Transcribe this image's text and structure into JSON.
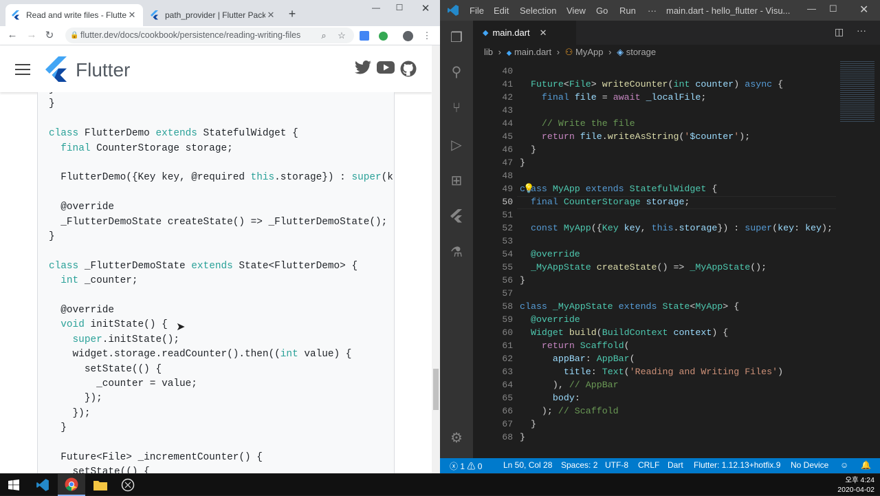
{
  "chrome": {
    "tabs": [
      {
        "title": "Read and write files - Flutter"
      },
      {
        "title": "path_provider | Flutter Package"
      }
    ],
    "url": "flutter.dev/docs/cookbook/persistence/reading-writing-files",
    "brand": "Flutter",
    "code_lines": [
      {
        "segs": [
          {
            "t": "}"
          }
        ]
      },
      {
        "segs": [
          {
            "t": "}"
          }
        ]
      },
      {
        "segs": [
          {
            "t": ""
          }
        ]
      },
      {
        "segs": [
          {
            "t": "class",
            "c": "k"
          },
          {
            "t": " FlutterDemo "
          },
          {
            "t": "extends",
            "c": "k"
          },
          {
            "t": " StatefulWidget {"
          }
        ]
      },
      {
        "segs": [
          {
            "t": "  "
          },
          {
            "t": "final",
            "c": "k"
          },
          {
            "t": " CounterStorage storage;"
          }
        ]
      },
      {
        "segs": [
          {
            "t": ""
          }
        ]
      },
      {
        "segs": [
          {
            "t": "  FlutterDemo({Key key, @required "
          },
          {
            "t": "this",
            "c": "k"
          },
          {
            "t": ".storage}) : "
          },
          {
            "t": "super",
            "c": "k"
          },
          {
            "t": "(k"
          }
        ]
      },
      {
        "segs": [
          {
            "t": ""
          }
        ]
      },
      {
        "segs": [
          {
            "t": "  @override"
          }
        ]
      },
      {
        "segs": [
          {
            "t": "  _FlutterDemoState createState() => _FlutterDemoState();"
          }
        ]
      },
      {
        "segs": [
          {
            "t": "}"
          }
        ]
      },
      {
        "segs": [
          {
            "t": ""
          }
        ]
      },
      {
        "segs": [
          {
            "t": "class",
            "c": "k"
          },
          {
            "t": " _FlutterDemoState "
          },
          {
            "t": "extends",
            "c": "k"
          },
          {
            "t": " State<FlutterDemo> {"
          }
        ]
      },
      {
        "segs": [
          {
            "t": "  "
          },
          {
            "t": "int",
            "c": "k"
          },
          {
            "t": " _counter;"
          }
        ]
      },
      {
        "segs": [
          {
            "t": ""
          }
        ]
      },
      {
        "segs": [
          {
            "t": "  @override"
          }
        ]
      },
      {
        "segs": [
          {
            "t": "  "
          },
          {
            "t": "void",
            "c": "k"
          },
          {
            "t": " initState() {"
          }
        ]
      },
      {
        "segs": [
          {
            "t": "    "
          },
          {
            "t": "super",
            "c": "k"
          },
          {
            "t": ".initState();"
          }
        ]
      },
      {
        "segs": [
          {
            "t": "    widget.storage.readCounter().then(("
          },
          {
            "t": "int",
            "c": "k"
          },
          {
            "t": " value) {"
          }
        ]
      },
      {
        "segs": [
          {
            "t": "      setState(() {"
          }
        ]
      },
      {
        "segs": [
          {
            "t": "        _counter = value;"
          }
        ]
      },
      {
        "segs": [
          {
            "t": "      });"
          }
        ]
      },
      {
        "segs": [
          {
            "t": "    });"
          }
        ]
      },
      {
        "segs": [
          {
            "t": "  }"
          }
        ]
      },
      {
        "segs": [
          {
            "t": ""
          }
        ]
      },
      {
        "segs": [
          {
            "t": "  Future<File> _incrementCounter() {"
          }
        ]
      },
      {
        "segs": [
          {
            "t": "    setState(() {"
          }
        ]
      }
    ]
  },
  "vscode": {
    "menu": [
      "File",
      "Edit",
      "Selection",
      "View",
      "Go",
      "Run",
      "···"
    ],
    "window_title": "main.dart - hello_flutter - Visu...",
    "tab": "main.dart",
    "breadcrumb": {
      "folder": "lib",
      "file": "main.dart",
      "class": "MyApp",
      "field": "storage"
    },
    "code": [
      {
        "n": "40",
        "segs": []
      },
      {
        "n": "41",
        "segs": [
          {
            "t": "  "
          },
          {
            "t": "Future",
            "c": "ty"
          },
          {
            "t": "<"
          },
          {
            "t": "File",
            "c": "ty"
          },
          {
            "t": "> "
          },
          {
            "t": "writeCounter",
            "c": "fn"
          },
          {
            "t": "("
          },
          {
            "t": "int",
            "c": "ty"
          },
          {
            "t": " "
          },
          {
            "t": "counter",
            "c": "vr"
          },
          {
            "t": ") "
          },
          {
            "t": "async",
            "c": "kw"
          },
          {
            "t": " {"
          }
        ]
      },
      {
        "n": "42",
        "segs": [
          {
            "t": "    "
          },
          {
            "t": "final",
            "c": "kw"
          },
          {
            "t": " "
          },
          {
            "t": "file",
            "c": "vr"
          },
          {
            "t": " = "
          },
          {
            "t": "await",
            "c": "ct"
          },
          {
            "t": " "
          },
          {
            "t": "_localFile",
            "c": "vr"
          },
          {
            "t": ";"
          }
        ]
      },
      {
        "n": "43",
        "segs": []
      },
      {
        "n": "44",
        "segs": [
          {
            "t": "    "
          },
          {
            "t": "// Write the file",
            "c": "cm"
          }
        ]
      },
      {
        "n": "45",
        "segs": [
          {
            "t": "    "
          },
          {
            "t": "return",
            "c": "ct"
          },
          {
            "t": " "
          },
          {
            "t": "file",
            "c": "vr"
          },
          {
            "t": "."
          },
          {
            "t": "writeAsString",
            "c": "fn"
          },
          {
            "t": "("
          },
          {
            "t": "'",
            "c": "st"
          },
          {
            "t": "$counter",
            "c": "vr"
          },
          {
            "t": "'",
            "c": "st"
          },
          {
            "t": ");"
          }
        ]
      },
      {
        "n": "46",
        "segs": [
          {
            "t": "  }"
          }
        ]
      },
      {
        "n": "47",
        "segs": [
          {
            "t": "}"
          }
        ]
      },
      {
        "n": "48",
        "segs": []
      },
      {
        "n": "49",
        "segs": [
          {
            "t": "class",
            "c": "kw"
          },
          {
            "t": " "
          },
          {
            "t": "MyApp",
            "c": "ty"
          },
          {
            "t": " "
          },
          {
            "t": "extends",
            "c": "kw"
          },
          {
            "t": " "
          },
          {
            "t": "StatefulWidget",
            "c": "ty"
          },
          {
            "t": " {"
          }
        ]
      },
      {
        "n": "50",
        "segs": [
          {
            "t": "  "
          },
          {
            "t": "final",
            "c": "kw"
          },
          {
            "t": " "
          },
          {
            "t": "CounterStorage",
            "c": "ty"
          },
          {
            "t": " "
          },
          {
            "t": "storage",
            "c": "vr"
          },
          {
            "t": ";"
          }
        ]
      },
      {
        "n": "51",
        "segs": []
      },
      {
        "n": "52",
        "segs": [
          {
            "t": "  "
          },
          {
            "t": "const",
            "c": "kw"
          },
          {
            "t": " "
          },
          {
            "t": "MyApp",
            "c": "ty"
          },
          {
            "t": "({"
          },
          {
            "t": "Key",
            "c": "ty"
          },
          {
            "t": " "
          },
          {
            "t": "key",
            "c": "vr"
          },
          {
            "t": ", "
          },
          {
            "t": "this",
            "c": "kw"
          },
          {
            "t": "."
          },
          {
            "t": "storage",
            "c": "vr"
          },
          {
            "t": "}) : "
          },
          {
            "t": "super",
            "c": "kw"
          },
          {
            "t": "("
          },
          {
            "t": "key",
            "c": "vr"
          },
          {
            "t": ": "
          },
          {
            "t": "key",
            "c": "vr"
          },
          {
            "t": ");"
          }
        ]
      },
      {
        "n": "53",
        "segs": []
      },
      {
        "n": "54",
        "segs": [
          {
            "t": "  "
          },
          {
            "t": "@override",
            "c": "ty"
          }
        ]
      },
      {
        "n": "55",
        "segs": [
          {
            "t": "  "
          },
          {
            "t": "_MyAppState",
            "c": "ty"
          },
          {
            "t": " "
          },
          {
            "t": "createState",
            "c": "fn"
          },
          {
            "t": "() => "
          },
          {
            "t": "_MyAppState",
            "c": "ty"
          },
          {
            "t": "();"
          }
        ]
      },
      {
        "n": "56",
        "segs": [
          {
            "t": "}"
          }
        ]
      },
      {
        "n": "57",
        "segs": []
      },
      {
        "n": "58",
        "segs": [
          {
            "t": "class",
            "c": "kw"
          },
          {
            "t": " "
          },
          {
            "t": "_MyAppState",
            "c": "ty"
          },
          {
            "t": " "
          },
          {
            "t": "extends",
            "c": "kw"
          },
          {
            "t": " "
          },
          {
            "t": "State",
            "c": "ty"
          },
          {
            "t": "<"
          },
          {
            "t": "MyApp",
            "c": "ty"
          },
          {
            "t": "> {"
          }
        ]
      },
      {
        "n": "59",
        "segs": [
          {
            "t": "  "
          },
          {
            "t": "@override",
            "c": "ty"
          }
        ]
      },
      {
        "n": "60",
        "segs": [
          {
            "t": "  "
          },
          {
            "t": "Widget",
            "c": "ty"
          },
          {
            "t": " "
          },
          {
            "t": "build",
            "c": "fn"
          },
          {
            "t": "("
          },
          {
            "t": "BuildContext",
            "c": "ty"
          },
          {
            "t": " "
          },
          {
            "t": "context",
            "c": "vr"
          },
          {
            "t": ") {"
          }
        ]
      },
      {
        "n": "61",
        "segs": [
          {
            "t": "    "
          },
          {
            "t": "return",
            "c": "ct"
          },
          {
            "t": " "
          },
          {
            "t": "Scaffold",
            "c": "ty"
          },
          {
            "t": "("
          }
        ]
      },
      {
        "n": "62",
        "segs": [
          {
            "t": "      "
          },
          {
            "t": "appBar",
            "c": "vr"
          },
          {
            "t": ": "
          },
          {
            "t": "AppBar",
            "c": "ty"
          },
          {
            "t": "("
          }
        ]
      },
      {
        "n": "63",
        "segs": [
          {
            "t": "        "
          },
          {
            "t": "title",
            "c": "vr"
          },
          {
            "t": ": "
          },
          {
            "t": "Text",
            "c": "ty"
          },
          {
            "t": "("
          },
          {
            "t": "'Reading and Writing Files'",
            "c": "st"
          },
          {
            "t": ")"
          }
        ]
      },
      {
        "n": "64",
        "segs": [
          {
            "t": "      ), "
          },
          {
            "t": "// AppBar",
            "c": "cm"
          }
        ]
      },
      {
        "n": "65",
        "segs": [
          {
            "t": "      "
          },
          {
            "t": "body",
            "c": "vr"
          },
          {
            "t": ":"
          }
        ]
      },
      {
        "n": "66",
        "segs": [
          {
            "t": "    ); "
          },
          {
            "t": "// Scaffold",
            "c": "cm"
          }
        ]
      },
      {
        "n": "67",
        "segs": [
          {
            "t": "  }"
          }
        ]
      },
      {
        "n": "68",
        "segs": [
          {
            "t": "}"
          }
        ]
      }
    ],
    "status": {
      "problems": "1",
      "warnings": "0",
      "position": "Ln 50, Col 28",
      "spaces": "Spaces: 2",
      "encoding": "UTF-8",
      "eol": "CRLF",
      "language": "Dart",
      "flutter": "Flutter: 1.12.13+hotfix.9",
      "device": "No Device"
    }
  },
  "taskbar": {
    "time": "오후 4:24",
    "date": "2020-04-02"
  }
}
